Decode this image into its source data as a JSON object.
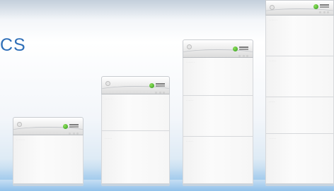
{
  "headline": "CS",
  "units": [
    {
      "id": "unit-1",
      "modules": [
        {
          "label": "· · · · · · ·",
          "tone": "light"
        }
      ]
    },
    {
      "id": "unit-2",
      "modules": [
        {
          "label": "· · · · · · ·",
          "tone": "light"
        },
        {
          "label": "· · · · · ·",
          "tone": "light"
        }
      ]
    },
    {
      "id": "unit-3",
      "modules": [
        {
          "label": "· · · · · · ·",
          "tone": "light"
        },
        {
          "label": "· · · · · ·",
          "tone": "light"
        },
        {
          "label": "· · · · · ·",
          "tone": "light"
        }
      ]
    },
    {
      "id": "unit-4",
      "modules": [
        {
          "label": "· · · · · · ·",
          "tone": "light"
        },
        {
          "label": "· · · · · ·",
          "tone": "light"
        },
        {
          "label": "· · · · ·",
          "tone": "dark"
        },
        {
          "label": "· · · · · ·",
          "tone": "light"
        }
      ]
    }
  ],
  "colors": {
    "headline": "#2f6fb8",
    "logo_green": "#2f9a1e",
    "background_top": "#e9eef4",
    "background_bottom": "#9fc9ec"
  },
  "icons": [
    "screw-icon",
    "brand-logo-icon",
    "status-led-icon"
  ]
}
